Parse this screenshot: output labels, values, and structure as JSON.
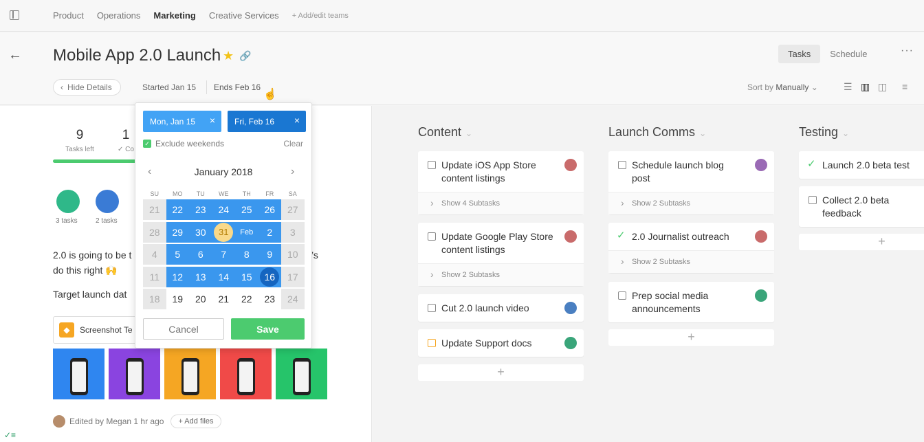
{
  "topbar": {
    "teams": [
      "Product",
      "Operations",
      "Marketing",
      "Creative Services"
    ],
    "active_team": "Marketing",
    "add_teams": "+ Add/edit teams"
  },
  "header": {
    "title": "Mobile App 2.0 Launch",
    "tabs": [
      "Tasks",
      "Schedule"
    ],
    "hide_details": "Hide Details",
    "started": "Started Jan 15",
    "ends": "Ends Feb 16",
    "sort_prefix": "Sort by",
    "sort_value": "Manually"
  },
  "left": {
    "stats": [
      {
        "num": "9",
        "label": "Tasks left"
      },
      {
        "num": "1",
        "label": "✓ Co"
      }
    ],
    "progress": 0.72,
    "people": [
      {
        "label": "3 tasks",
        "color": "#2fb889"
      },
      {
        "label": "2 tasks",
        "color": "#3a7bd5"
      }
    ],
    "desc_line1": "2.0 is going to be t",
    "desc_line1_end": "’s",
    "desc_line2": "do this right 🙌",
    "target": "Target launch dat",
    "file_name": "Screenshot Te",
    "thumb_colors": [
      "#2f86f0",
      "#8a44e0",
      "#f5a623",
      "#f04a48",
      "#26c46a"
    ],
    "edited": "Edited by Megan 1 hr ago",
    "add_files": "+ Add files"
  },
  "datepicker": {
    "start_chip": "Mon, Jan 15",
    "end_chip": "Fri, Feb 16",
    "exclude_weekends": "Exclude weekends",
    "clear": "Clear",
    "month": "January 2018",
    "weekdays": [
      "SU",
      "MO",
      "TU",
      "WE",
      "TH",
      "FR",
      "SA"
    ],
    "weeks": [
      [
        "21",
        "22",
        "23",
        "24",
        "25",
        "26",
        "27"
      ],
      [
        "28",
        "29",
        "30",
        "31",
        "Feb",
        "2",
        "3"
      ],
      [
        "4",
        "5",
        "6",
        "7",
        "8",
        "9",
        "10"
      ],
      [
        "11",
        "12",
        "13",
        "14",
        "15",
        "16",
        "17"
      ],
      [
        "18",
        "19",
        "20",
        "21",
        "22",
        "23",
        "24"
      ]
    ],
    "cancel": "Cancel",
    "save": "Save"
  },
  "board": {
    "columns": [
      {
        "title": "Content",
        "cards": [
          {
            "line1": "Update iOS App Store",
            "line2": "content listings",
            "sub": "Show 4 Subtasks",
            "state": "open",
            "avatar": "#c96b6b"
          },
          {
            "line1": "Update Google Play Store",
            "line2": "content listings",
            "sub": "Show 2 Subtasks",
            "state": "open",
            "avatar": "#c96b6b"
          },
          {
            "line1": "Cut 2.0 launch video",
            "line2": "",
            "sub": "",
            "state": "open",
            "avatar": "#4a7fc1"
          },
          {
            "line1": "Update Support docs",
            "line2": "",
            "sub": "",
            "state": "orange",
            "avatar": "#3aa57a"
          }
        ]
      },
      {
        "title": "Launch Comms",
        "cards": [
          {
            "line1": "Schedule launch blog",
            "line2": "post",
            "sub": "Show 2 Subtasks",
            "state": "open",
            "avatar": "#9a6ab5"
          },
          {
            "line1": "2.0 Journalist outreach",
            "line2": "",
            "sub": "Show 2 Subtasks",
            "state": "done",
            "avatar": "#c96b6b"
          },
          {
            "line1": "Prep social media",
            "line2": "announcements",
            "sub": "",
            "state": "open",
            "avatar": "#3aa57a"
          }
        ]
      },
      {
        "title": "Testing",
        "cards": [
          {
            "line1": "Launch 2.0 beta test",
            "line2": "",
            "sub": "",
            "state": "done",
            "avatar": ""
          },
          {
            "line1": "Collect 2.0 beta",
            "line2": "feedback",
            "sub": "",
            "state": "open",
            "avatar": ""
          }
        ]
      }
    ]
  }
}
